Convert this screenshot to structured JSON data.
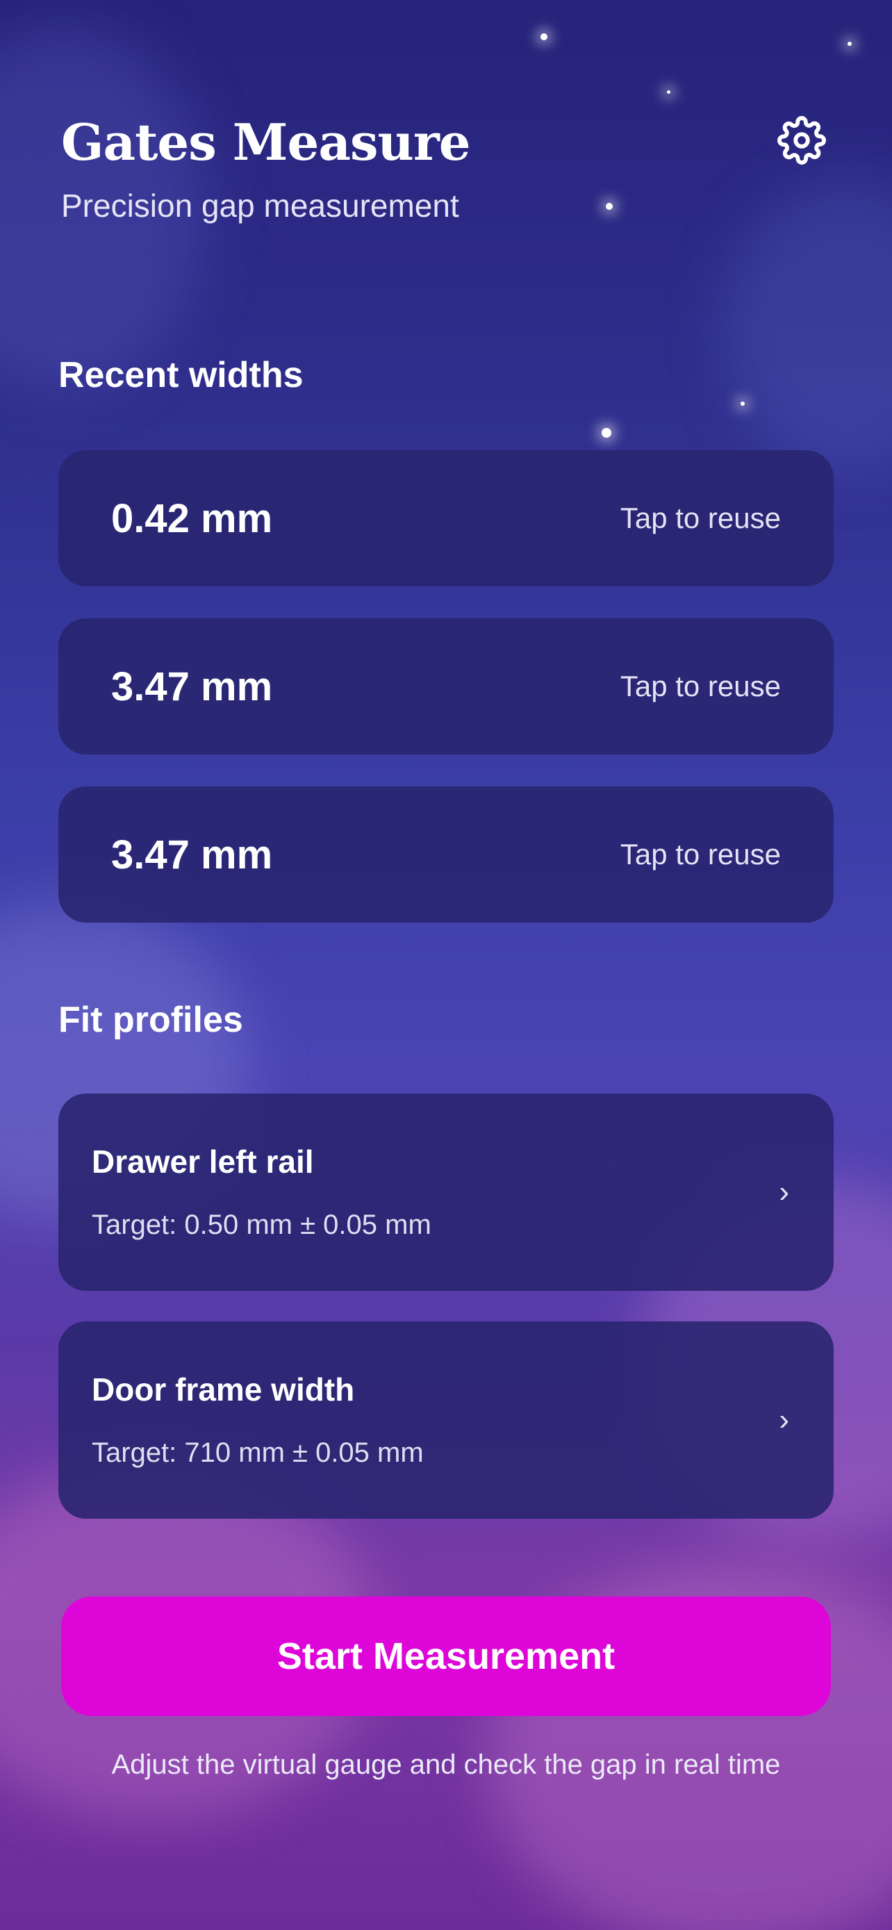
{
  "header": {
    "title": "Gates Measure",
    "subtitle": "Precision gap measurement",
    "settings_icon": "gear-icon"
  },
  "recent": {
    "section_title": "Recent widths",
    "items": [
      {
        "value": "0.42 mm",
        "hint": "Tap to reuse"
      },
      {
        "value": "3.47 mm",
        "hint": "Tap to reuse"
      },
      {
        "value": "3.47 mm",
        "hint": "Tap to reuse"
      }
    ]
  },
  "profiles": {
    "section_title": "Fit profiles",
    "items": [
      {
        "name": "Drawer left rail",
        "target": "Target: 0.50 mm ± 0.05 mm",
        "icon": "chevron-right-icon"
      },
      {
        "name": "Door frame width",
        "target": "Target: 710 mm ± 0.05 mm",
        "icon": "chevron-right-icon"
      }
    ]
  },
  "actions": {
    "start_label": "Start Measurement",
    "hint": "Adjust the virtual gauge and check the gap in real time"
  },
  "colors": {
    "accent": "#dd05d8",
    "card": "#28246e",
    "background_top": "#26237a",
    "background_bottom": "#6c2c9a"
  }
}
